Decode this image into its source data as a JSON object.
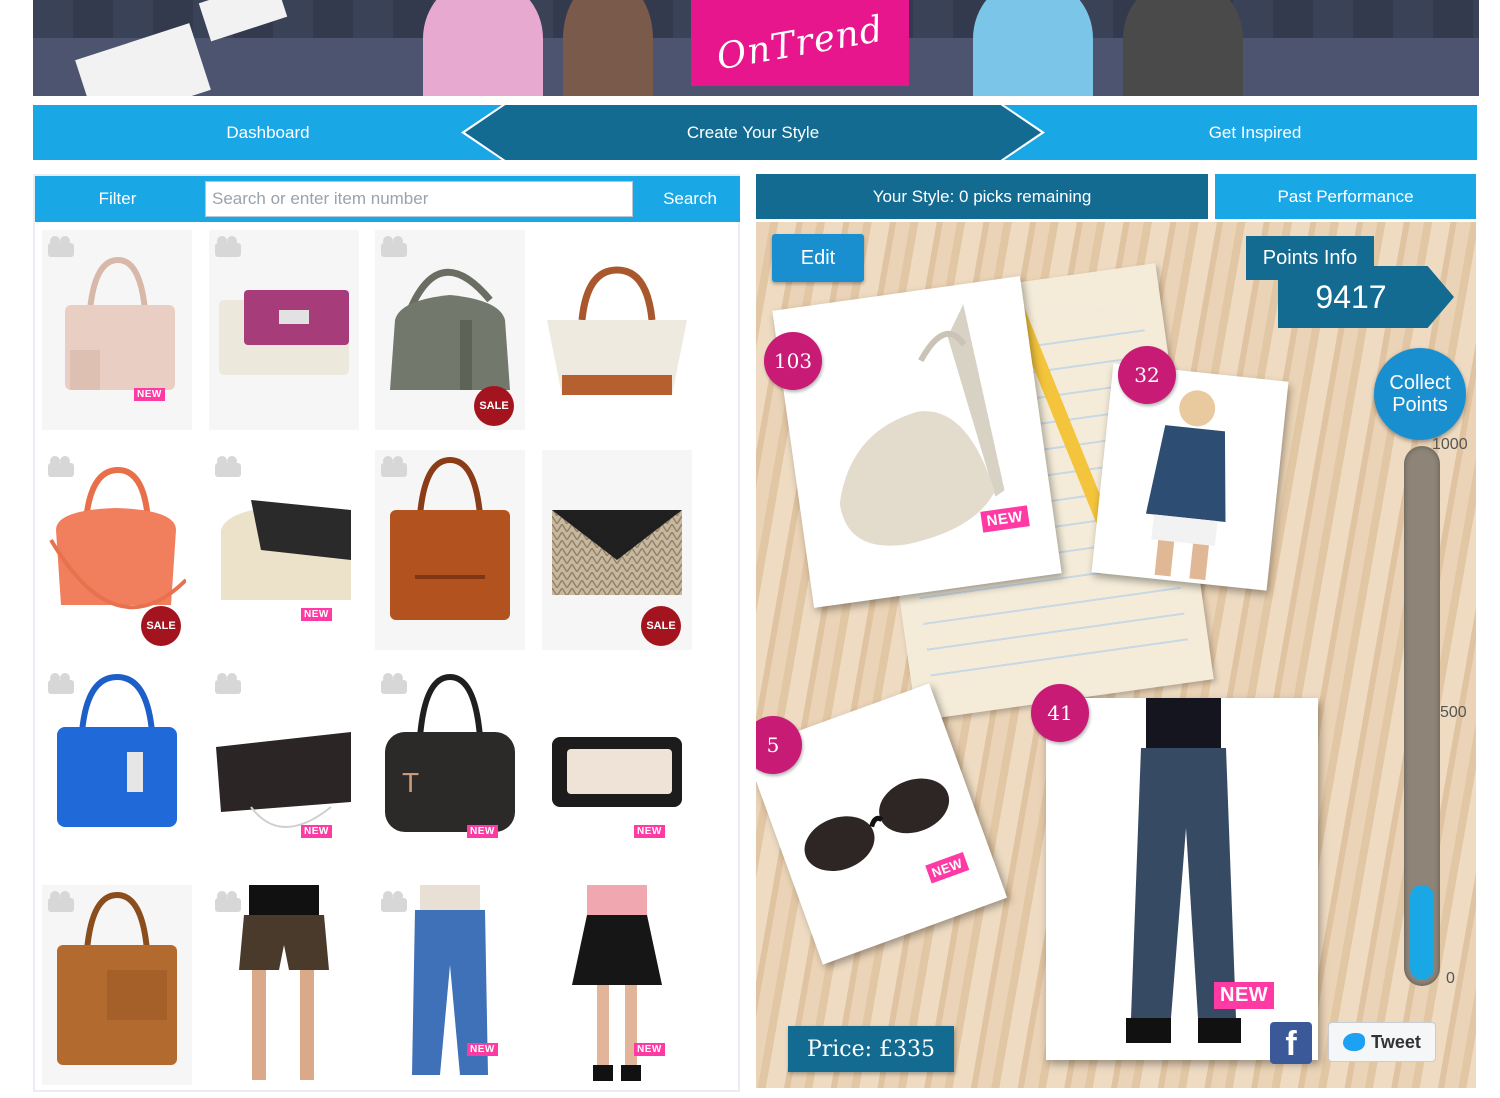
{
  "banner": {
    "logo_text": "OnTrend"
  },
  "nav": {
    "tabs": [
      {
        "label": "Dashboard"
      },
      {
        "label": "Create Your Style"
      },
      {
        "label": "Get Inspired"
      }
    ],
    "active_tab": "Create Your Style"
  },
  "catalog": {
    "filter_label": "Filter",
    "search_placeholder": "Search or enter item number",
    "search_value": "",
    "search_button": "Search",
    "items": [
      {
        "kind": "bag-tote-pink",
        "badge": "NEW"
      },
      {
        "kind": "purse-pink",
        "badge": ""
      },
      {
        "kind": "bag-hobo-grey",
        "badge": "SALE"
      },
      {
        "kind": "bag-white-tan",
        "badge": ""
      },
      {
        "kind": "bag-orange",
        "badge": "SALE"
      },
      {
        "kind": "bag-black-cream",
        "badge": "NEW"
      },
      {
        "kind": "bag-tan-brown",
        "badge": ""
      },
      {
        "kind": "clutch-pattern",
        "badge": "SALE"
      },
      {
        "kind": "bag-blue",
        "badge": ""
      },
      {
        "kind": "clutch-black",
        "badge": "NEW"
      },
      {
        "kind": "bag-black-duffle",
        "badge": "NEW"
      },
      {
        "kind": "purse-black",
        "badge": "NEW"
      },
      {
        "kind": "bag-brown-satchel",
        "badge": ""
      },
      {
        "kind": "shorts-print",
        "badge": ""
      },
      {
        "kind": "jeans-blue",
        "badge": "NEW"
      },
      {
        "kind": "skirt-black",
        "badge": "NEW"
      }
    ]
  },
  "style": {
    "header": "Your Style: 0 picks remaining",
    "past_performance": "Past Performance",
    "edit_label": "Edit",
    "points_info_label": "Points Info",
    "points_value": "9417",
    "collect_label_line1": "Collect",
    "collect_label_line2": "Points",
    "meter": {
      "max": 1000,
      "mid": 500,
      "min": 0,
      "value": 180,
      "tick_max": "1000",
      "tick_mid": "500",
      "tick_min": "0"
    },
    "picks": [
      {
        "pin": "103",
        "item": "shoe-peeptoe",
        "badge": "NEW"
      },
      {
        "pin": "32",
        "item": "denim-shirt",
        "badge": ""
      },
      {
        "pin": "5",
        "item": "sunglasses",
        "badge": "NEW"
      },
      {
        "pin": "41",
        "item": "jeans-skinny",
        "badge": "NEW"
      }
    ],
    "price": "Price: £335",
    "tweet_label": "Tweet",
    "facebook_label": "f"
  },
  "colors": {
    "primary": "#1aa7e6",
    "dark": "#136b92",
    "pink": "#e8168c",
    "sale": "#a3141e"
  }
}
